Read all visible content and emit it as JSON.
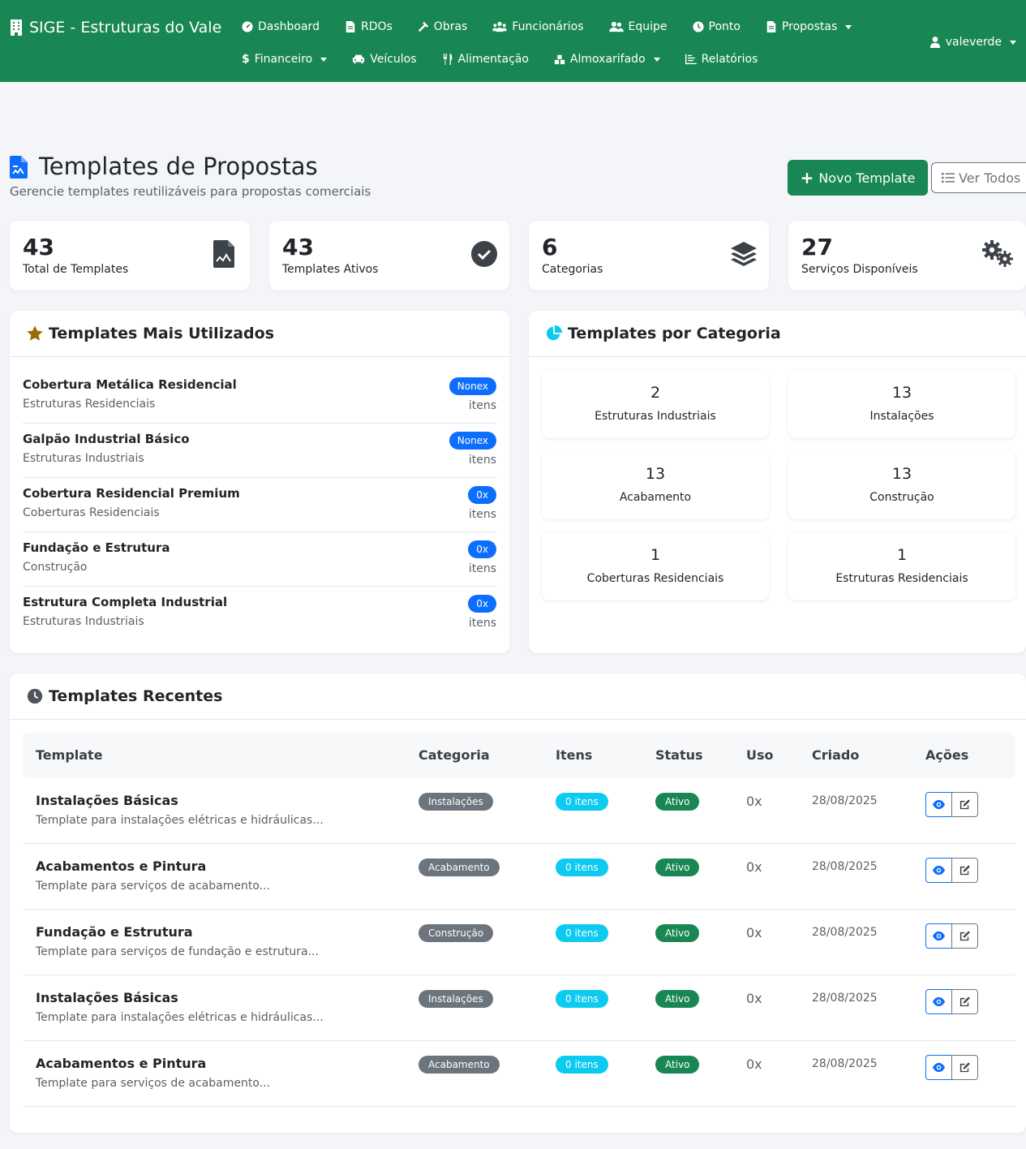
{
  "app": {
    "brand": "SIGE - Estruturas do Vale",
    "brand_color": "#198753",
    "nav_row1": [
      {
        "label": "Dashboard",
        "icon": "dashboard-icon"
      },
      {
        "label": "RDOs",
        "icon": "document-icon"
      },
      {
        "label": "Obras",
        "icon": "hammer-icon"
      },
      {
        "label": "Funcionários",
        "icon": "users-icon"
      },
      {
        "label": "Equipe",
        "icon": "team-icon"
      },
      {
        "label": "Ponto",
        "icon": "clock-icon"
      },
      {
        "label": "Propostas",
        "icon": "document-icon",
        "dropdown": true
      }
    ],
    "nav_row2": [
      {
        "label": "Financeiro",
        "icon": "dollar-icon",
        "dropdown": true
      },
      {
        "label": "Veículos",
        "icon": "car-icon"
      },
      {
        "label": "Alimentação",
        "icon": "utensils-icon"
      },
      {
        "label": "Almoxarifado",
        "icon": "warehouse-icon",
        "dropdown": true
      },
      {
        "label": "Relatórios",
        "icon": "chart-icon"
      }
    ],
    "user": "valeverde"
  },
  "header": {
    "title": "Templates de Propostas",
    "subtitle": "Gerencie templates reutilizáveis para propostas comerciais",
    "new_button": "Novo Template",
    "all_button": "Ver Todos"
  },
  "stats": [
    {
      "value": "43",
      "label": "Total de Templates",
      "icon": "file-chart-icon"
    },
    {
      "value": "43",
      "label": "Templates Ativos",
      "icon": "check-circle-icon"
    },
    {
      "value": "6",
      "label": "Categorias",
      "icon": "layers-icon"
    },
    {
      "value": "27",
      "label": "Serviços Disponíveis",
      "icon": "gears-icon"
    }
  ],
  "most_used": {
    "title": "Templates Mais Utilizados",
    "unit": "itens",
    "items": [
      {
        "name": "Cobertura Metálica Residencial",
        "category": "Estruturas Residenciais",
        "badge": "Nonex"
      },
      {
        "name": "Galpão Industrial Básico",
        "category": "Estruturas Industriais",
        "badge": "Nonex"
      },
      {
        "name": "Cobertura Residencial Premium",
        "category": "Coberturas Residenciais",
        "badge": "0x"
      },
      {
        "name": "Fundação e Estrutura",
        "category": "Construção",
        "badge": "0x"
      },
      {
        "name": "Estrutura Completa Industrial",
        "category": "Estruturas Industriais",
        "badge": "0x"
      }
    ]
  },
  "by_category": {
    "title": "Templates por Categoria",
    "items": [
      {
        "count": "2",
        "label": "Estruturas Industriais"
      },
      {
        "count": "13",
        "label": "Instalações"
      },
      {
        "count": "13",
        "label": "Acabamento"
      },
      {
        "count": "13",
        "label": "Construção"
      },
      {
        "count": "1",
        "label": "Coberturas Residenciais"
      },
      {
        "count": "1",
        "label": "Estruturas Residenciais"
      }
    ]
  },
  "recent": {
    "title": "Templates Recentes",
    "columns": [
      "Template",
      "Categoria",
      "Itens",
      "Status",
      "Uso",
      "Criado",
      "Ações"
    ],
    "rows": [
      {
        "name": "Instalações Básicas",
        "desc": "Template para instalações elétricas e hidráulicas...",
        "category": "Instalações",
        "itens": "0 itens",
        "status": "Ativo",
        "uso": "0x",
        "created": "28/08/2025"
      },
      {
        "name": "Acabamentos e Pintura",
        "desc": "Template para serviços de acabamento...",
        "category": "Acabamento",
        "itens": "0 itens",
        "status": "Ativo",
        "uso": "0x",
        "created": "28/08/2025"
      },
      {
        "name": "Fundação e Estrutura",
        "desc": "Template para serviços de fundação e estrutura...",
        "category": "Construção",
        "itens": "0 itens",
        "status": "Ativo",
        "uso": "0x",
        "created": "28/08/2025"
      },
      {
        "name": "Instalações Básicas",
        "desc": "Template para instalações elétricas e hidráulicas...",
        "category": "Instalações",
        "itens": "0 itens",
        "status": "Ativo",
        "uso": "0x",
        "created": "28/08/2025"
      },
      {
        "name": "Acabamentos e Pintura",
        "desc": "Template para serviços de acabamento...",
        "category": "Acabamento",
        "itens": "0 itens",
        "status": "Ativo",
        "uso": "0x",
        "created": "28/08/2025"
      }
    ]
  }
}
